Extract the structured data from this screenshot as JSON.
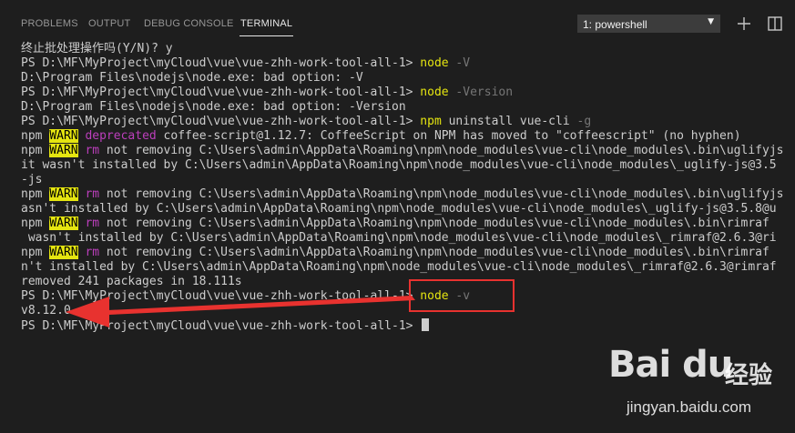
{
  "tabs": [
    {
      "label": "PROBLEMS"
    },
    {
      "label": "OUTPUT"
    },
    {
      "label": "DEBUG CONSOLE"
    },
    {
      "label": "TERMINAL"
    }
  ],
  "active_tab": "TERMINAL",
  "terminal_select": {
    "value": "1: powershell",
    "arrow": "▼"
  },
  "toolbar": {
    "add_icon": "plus-icon",
    "split_icon": "split-terminal-icon"
  },
  "terminal": {
    "lines": [
      [
        {
          "t": "终止批处理操作吗(Y/N)? y"
        }
      ],
      [
        {
          "t": "PS D:\\MF\\MyProject\\myCloud\\vue\\vue-zhh-work-tool-all-1> "
        },
        {
          "t": "node",
          "c": "y"
        },
        {
          "t": " -V",
          "c": "g"
        }
      ],
      [
        {
          "t": "D:\\Program Files\\nodejs\\node.exe: bad option: -V"
        }
      ],
      [
        {
          "t": "PS D:\\MF\\MyProject\\myCloud\\vue\\vue-zhh-work-tool-all-1> "
        },
        {
          "t": "node",
          "c": "y"
        },
        {
          "t": " -Version",
          "c": "g"
        }
      ],
      [
        {
          "t": "D:\\Program Files\\nodejs\\node.exe: bad option: -Version"
        }
      ],
      [
        {
          "t": "PS D:\\MF\\MyProject\\myCloud\\vue\\vue-zhh-work-tool-all-1> "
        },
        {
          "t": "npm",
          "c": "y"
        },
        {
          "t": " uninstall vue-cli "
        },
        {
          "t": "-g",
          "c": "g"
        }
      ],
      [
        {
          "t": "npm "
        },
        {
          "t": "WARN",
          "c": "w"
        },
        {
          "t": " "
        },
        {
          "t": "deprecated",
          "c": "m"
        },
        {
          "t": " coffee-script@1.12.7: CoffeeScript on NPM has moved to \"coffeescript\" (no hyphen)"
        }
      ],
      [
        {
          "t": "npm "
        },
        {
          "t": "WARN",
          "c": "w"
        },
        {
          "t": " "
        },
        {
          "t": "rm",
          "c": "m"
        },
        {
          "t": " not removing C:\\Users\\admin\\AppData\\Roaming\\npm\\node_modules\\vue-cli\\node_modules\\.bin\\uglifyjs"
        }
      ],
      [
        {
          "t": "it wasn't installed by C:\\Users\\admin\\AppData\\Roaming\\npm\\node_modules\\vue-cli\\node_modules\\_uglify-js@3.5"
        }
      ],
      [
        {
          "t": "-js"
        }
      ],
      [
        {
          "t": "npm "
        },
        {
          "t": "WARN",
          "c": "w"
        },
        {
          "t": " "
        },
        {
          "t": "rm",
          "c": "m"
        },
        {
          "t": " not removing C:\\Users\\admin\\AppData\\Roaming\\npm\\node_modules\\vue-cli\\node_modules\\.bin\\uglifyjs"
        }
      ],
      [
        {
          "t": "asn't installed by C:\\Users\\admin\\AppData\\Roaming\\npm\\node_modules\\vue-cli\\node_modules\\_uglify-js@3.5.8@u"
        }
      ],
      [
        {
          "t": "npm "
        },
        {
          "t": "WARN",
          "c": "w"
        },
        {
          "t": " "
        },
        {
          "t": "rm",
          "c": "m"
        },
        {
          "t": " not removing C:\\Users\\admin\\AppData\\Roaming\\npm\\node_modules\\vue-cli\\node_modules\\.bin\\rimraf"
        }
      ],
      [
        {
          "t": " wasn't installed by C:\\Users\\admin\\AppData\\Roaming\\npm\\node_modules\\vue-cli\\node_modules\\_rimraf@2.6.3@ri"
        }
      ],
      [
        {
          "t": "npm "
        },
        {
          "t": "WARN",
          "c": "w"
        },
        {
          "t": " "
        },
        {
          "t": "rm",
          "c": "m"
        },
        {
          "t": " not removing C:\\Users\\admin\\AppData\\Roaming\\npm\\node_modules\\vue-cli\\node_modules\\.bin\\rimraf"
        }
      ],
      [
        {
          "t": "n't installed by C:\\Users\\admin\\AppData\\Roaming\\npm\\node_modules\\vue-cli\\node_modules\\_rimraf@2.6.3@rimraf"
        }
      ],
      [
        {
          "t": "removed 241 packages in 18.111s"
        }
      ],
      [
        {
          "t": "PS D:\\MF\\MyProject\\myCloud\\vue\\vue-zhh-work-tool-all-1> "
        },
        {
          "t": "node",
          "c": "y"
        },
        {
          "t": " -v",
          "c": "g"
        }
      ],
      [
        {
          "t": "v8.12.0"
        }
      ],
      [
        {
          "t": "PS D:\\MF\\MyProject\\myCloud\\vue\\vue-zhh-work-tool-all-1> "
        }
      ]
    ]
  },
  "colors": {
    "background": "#1e1e1e",
    "annotation": "#e8322f",
    "warn_bg": "#e5e510",
    "keyword": "#bc3fbc"
  },
  "watermark": {
    "logo": "Bai du",
    "cn": "经验",
    "url": "jingyan.baidu.com"
  }
}
